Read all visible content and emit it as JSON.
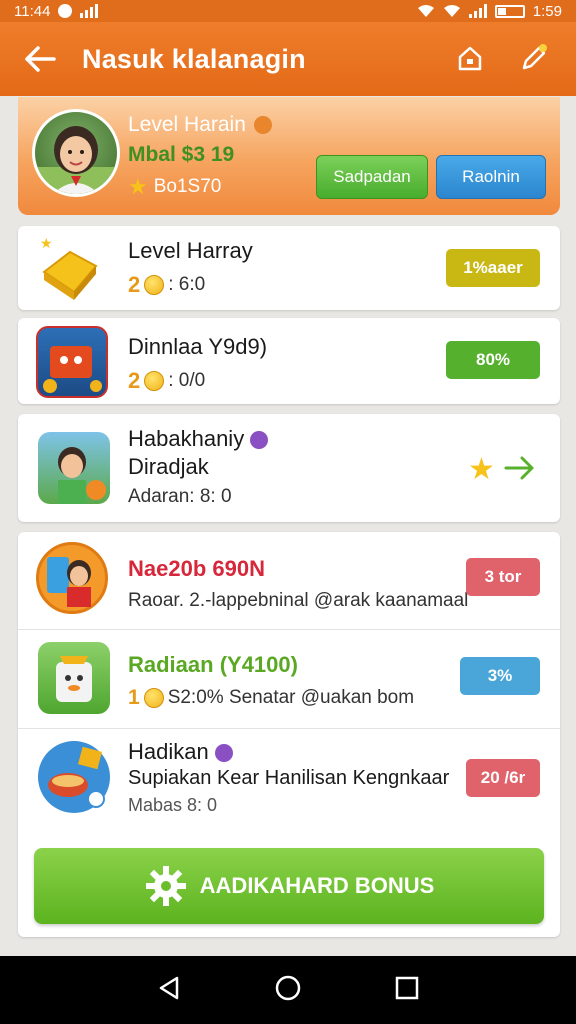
{
  "status_bar": {
    "time": "11:44",
    "clock_right": "1:59"
  },
  "app_bar": {
    "title": "Nasuk klalanagin"
  },
  "profile": {
    "level": "Level Harain",
    "money": "Mbal $3 19",
    "bonus": "Bo1S70",
    "button_left": "Sadpadan",
    "button_right": "Raolnin"
  },
  "cards": [
    {
      "title": "Level Harray",
      "sub_num": "2",
      "sub_text": ": 6:0",
      "pill": "1%aaer",
      "pill_color": "#c9b814"
    },
    {
      "title": "Dinnlaa Y9d9)",
      "sub_num": "2",
      "sub_text": ": 0/0",
      "pill": "80%",
      "pill_color": "#55b02e"
    },
    {
      "title": "Habakhaniy",
      "title2": "Diradjak",
      "sub_text": "Adaran: 8: 0"
    }
  ],
  "list": [
    {
      "title": "Nae20b 690N",
      "title_color": "#d6283a",
      "sub_text": "Raoar. 2.-lappebninal @arak kaanamaal",
      "pill": "3 tor",
      "pill_color": "#e0626b"
    },
    {
      "title": "Radiaan (Y4100)",
      "title_color": "#5aa823",
      "sub_num": "1",
      "sub_text": "S2:0% Senatar @uakan bom",
      "pill": "3%",
      "pill_color": "#4aa6d8"
    },
    {
      "title": "Hadikan",
      "title_color": "#1a1a1a",
      "sub_text": "Supiakan Kear Hanilisan Kengnkaar",
      "sub_text2": "Mabas 8: 0",
      "pill": "20 /6r",
      "pill_color": "#e0626b"
    }
  ],
  "cta": {
    "label": "AADIKAHARD BONUS"
  },
  "colors": {
    "brand_orange": "#e8731f",
    "green": "#5cb31f",
    "blue": "#2c86cf"
  }
}
